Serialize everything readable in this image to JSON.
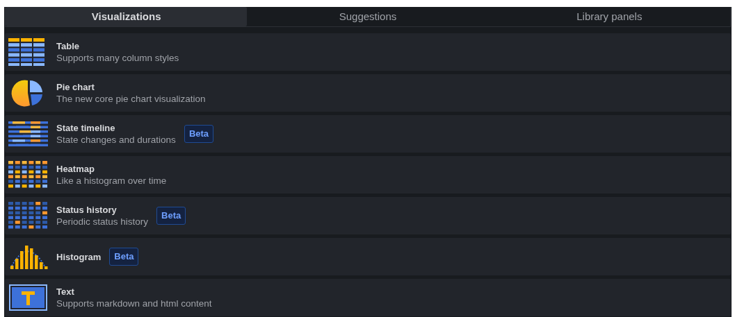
{
  "tabs": [
    {
      "label": "Visualizations",
      "selected": true
    },
    {
      "label": "Suggestions",
      "selected": false
    },
    {
      "label": "Library panels",
      "selected": false
    }
  ],
  "items": [
    {
      "kind": "table",
      "name": "Table",
      "description": "Supports many column styles"
    },
    {
      "kind": "pie",
      "name": "Pie chart",
      "description": "The new core pie chart visualization"
    },
    {
      "kind": "timeline",
      "name": "State timeline",
      "description": "State changes and durations",
      "badge": "Beta"
    },
    {
      "kind": "heatmap",
      "name": "Heatmap",
      "description": "Like a histogram over time"
    },
    {
      "kind": "status",
      "name": "Status history",
      "description": "Periodic status history",
      "badge": "Beta"
    },
    {
      "kind": "histogram",
      "name": "Histogram",
      "badge": "Beta"
    },
    {
      "kind": "text",
      "name": "Text",
      "description": "Supports markdown and html content"
    }
  ]
}
